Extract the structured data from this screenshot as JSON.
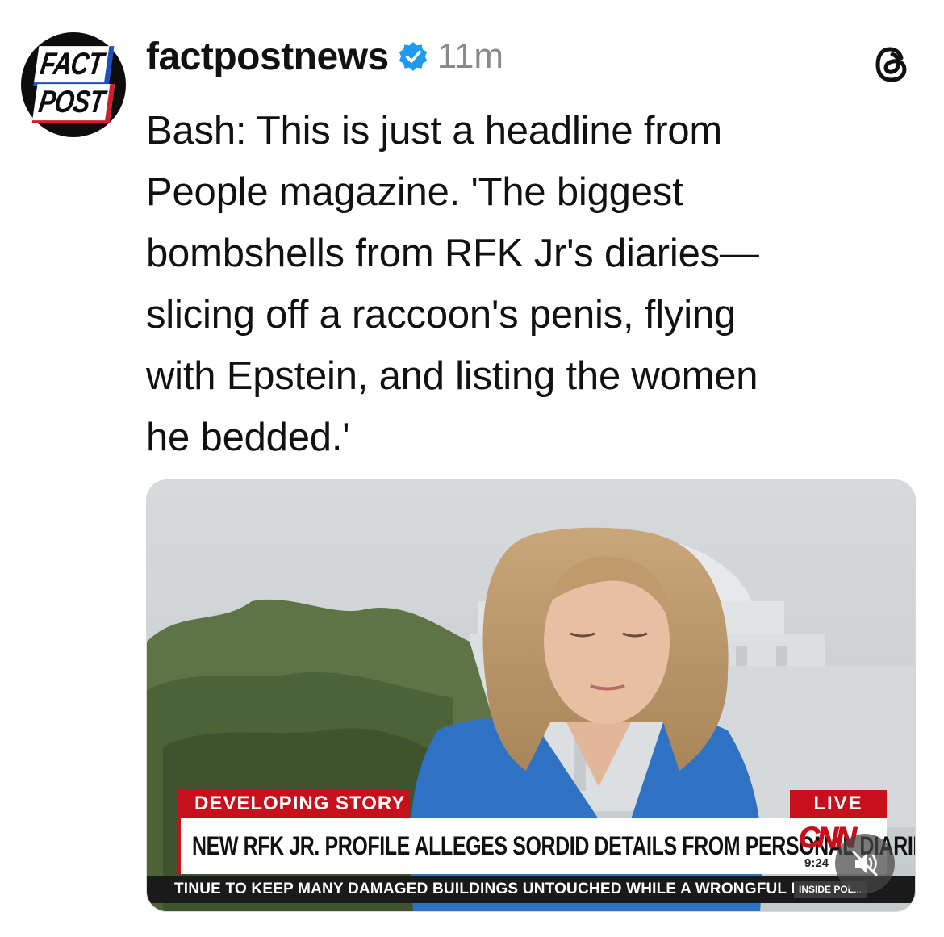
{
  "avatar": {
    "line1": "FACT",
    "line2": "POST"
  },
  "post": {
    "username": "factpostnews",
    "timestamp": "11m",
    "text": "Bash: This is just a headline from\nPeople magazine. 'The biggest\nbombshells from RFK Jr's diaries—\nslicing off a raccoon's penis, flying\nwith Epstein, and listing the women\nhe bedded.'"
  },
  "video": {
    "developing_label": "DEVELOPING STORY",
    "live_label": "LIVE",
    "headline": "NEW RFK JR. PROFILE ALLEGES SORDID DETAILS FROM PERSONAL DIARIES",
    "network_logo": "CNN",
    "clock": "9:24",
    "ticker": "TINUE TO KEEP MANY DAMAGED BUILDINGS UNTOUCHED WHILE A WRONGFUL DEATH",
    "ticker_tag": "INSIDE POL...",
    "muted": true
  },
  "icons": {
    "verified": "verified-badge-icon",
    "threads": "threads-logo-icon",
    "mute": "speaker-muted-icon"
  },
  "colors": {
    "verified": "#1d9bf0",
    "cnn_red": "#c8101c",
    "timestamp": "#8a8a8a"
  }
}
